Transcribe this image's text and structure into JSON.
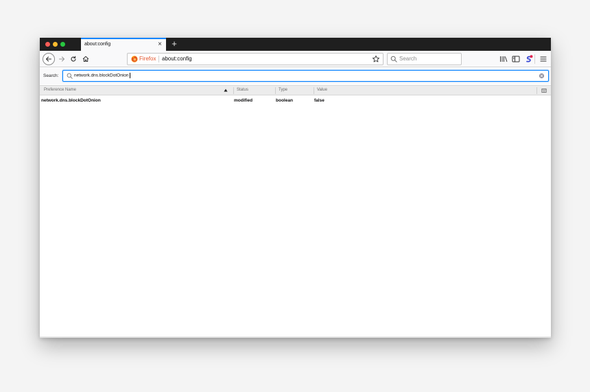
{
  "tab": {
    "title": "about:config",
    "close": "×",
    "new_tab": "+"
  },
  "urlbar": {
    "brand": "Firefox",
    "url": "about:config"
  },
  "searchbar": {
    "placeholder": "Search"
  },
  "prefs_search": {
    "label": "Search:",
    "value": "network.dns.blockDotOnion"
  },
  "table": {
    "columns": [
      "Preference Name",
      "Status",
      "Type",
      "Value"
    ],
    "rows": [
      {
        "name": "network.dns.blockDotOnion",
        "status": "modified",
        "type": "boolean",
        "value": "false"
      }
    ]
  },
  "colors": {
    "accent": "#0a84ff",
    "firefox_orange": "#e2542c",
    "titlebar": "#1f1f1f"
  },
  "icons": [
    "back-icon",
    "forward-icon",
    "reload-icon",
    "home-icon",
    "firefox-logo-icon",
    "star-icon",
    "search-icon",
    "library-icon",
    "sidebar-icon",
    "extension-icon",
    "menu-icon",
    "clear-icon",
    "sort-arrow-icon",
    "column-picker-icon"
  ]
}
